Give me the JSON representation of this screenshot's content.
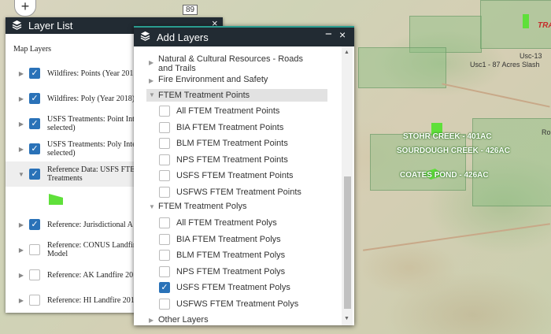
{
  "map": {
    "highway": "89",
    "labels": {
      "stohr": "STOHR CREEK - 401AC",
      "sourdough": "SOURDOUGH CREEK - 426AC",
      "coates": "COATES POND - 426AC",
      "usc13": "Usc-13",
      "usc1": "Usc1 - 87 Acres Slash",
      "tra": "TRA",
      "ro": "Ro"
    },
    "zoom_in": "+"
  },
  "layer_list": {
    "title": "Layer List",
    "close": "×",
    "subtitle": "Map Layers",
    "items": [
      {
        "label": "Wildfires: Points (Year 201",
        "checked": true
      },
      {
        "label": "Wildfires: Poly (Year 2018)",
        "checked": true
      },
      {
        "label": "USFS Treatments: Point Int\nselected)",
        "checked": true
      },
      {
        "label": "USFS Treatments: Poly Inte\nselected)",
        "checked": true
      },
      {
        "label": "Reference Data: USFS FTE\nTreatments",
        "checked": true,
        "expanded": true
      },
      {
        "label": "Reference: Jurisdictional A",
        "checked": true
      },
      {
        "label": "Reference: CONUS Landfir\nModel",
        "checked": false
      },
      {
        "label": "Reference: AK Landfire 20",
        "checked": false
      },
      {
        "label": "Reference: HI Landfire 201",
        "checked": false
      }
    ]
  },
  "add_layers": {
    "title": "Add Layers",
    "minimize": "−",
    "close": "×",
    "categories": {
      "roads": "Natural & Cultural Resources - Roads and Trails",
      "fire_env": "Fire Environment and Safety",
      "ftem_points": "FTEM Treatment Points",
      "ftem_polys": "FTEM Treatment Polys",
      "other": "Other Layers"
    },
    "points_items": [
      {
        "label": "All FTEM Treatment Points",
        "checked": false
      },
      {
        "label": "BIA FTEM Treatment Points",
        "checked": false
      },
      {
        "label": "BLM FTEM Treatment Points",
        "checked": false
      },
      {
        "label": "NPS FTEM Treatment Points",
        "checked": false
      },
      {
        "label": "USFS FTEM Treatment Points",
        "checked": false
      },
      {
        "label": "USFWS FTEM Treatment Points",
        "checked": false
      }
    ],
    "polys_items": [
      {
        "label": "All FTEM Treatment Polys",
        "checked": false
      },
      {
        "label": "BIA FTEM Treatment Polys",
        "checked": false
      },
      {
        "label": "BLM FTEM Treatment Polys",
        "checked": false
      },
      {
        "label": "NPS FTEM Treatment Polys",
        "checked": false
      },
      {
        "label": "USFS FTEM Treatment Polys",
        "checked": true
      },
      {
        "label": "USFWS FTEM Treatment Polys",
        "checked": false
      }
    ]
  },
  "colors": {
    "header": "#222b33",
    "accent": "#2a72b8",
    "legend_green": "#5fe03a"
  }
}
